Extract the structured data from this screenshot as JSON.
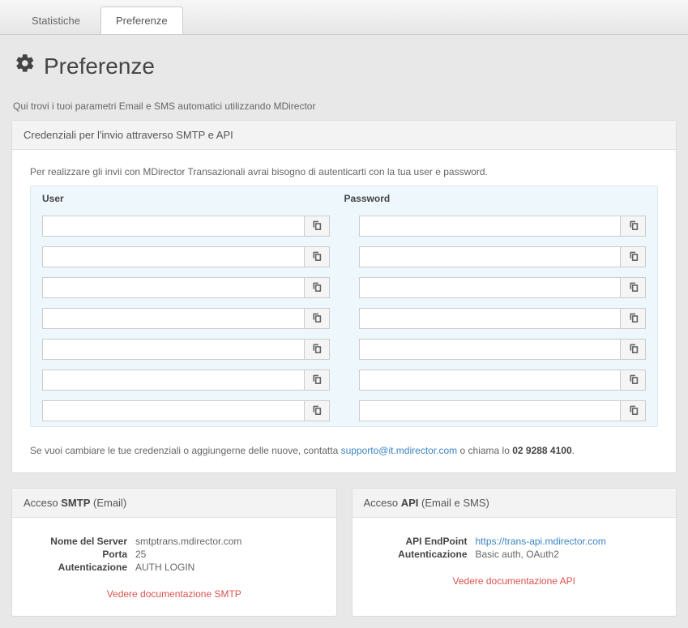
{
  "tabs": {
    "stats": "Statistiche",
    "prefs": "Preferenze"
  },
  "page_title": "Preferenze",
  "intro": "Qui trovi i tuoi parametri Email e SMS automatici utilizzando MDirector",
  "cred_panel": {
    "header": "Credenziali per l'invio attraverso SMTP e API",
    "hint": "Per realizzare gli invii con MDirector Transazionali avrai bisogno di autenticarti con la tua user e password.",
    "col_user": "User",
    "col_password": "Password",
    "rows": [
      {
        "user": "",
        "password": ""
      },
      {
        "user": "",
        "password": ""
      },
      {
        "user": "",
        "password": ""
      },
      {
        "user": "",
        "password": ""
      },
      {
        "user": "",
        "password": ""
      },
      {
        "user": "",
        "password": ""
      },
      {
        "user": "",
        "password": ""
      }
    ],
    "foot_pre": "Se vuoi cambiare le tue credenziali o aggiungerne delle nuove, contatta ",
    "foot_email": "supporto@it.mdirector.com",
    "foot_mid": " o chiama lo ",
    "foot_phone": "02 9288 4100",
    "foot_post": "."
  },
  "smtp_panel": {
    "header_pre": "Acceso ",
    "header_bold": "SMTP",
    "header_post": " (Email)",
    "server_label": "Nome del Server",
    "server_value": "smtptrans.mdirector.com",
    "port_label": "Porta",
    "port_value": "25",
    "auth_label": "Autenticazione",
    "auth_value": "AUTH LOGIN",
    "doc_link": "Vedere documentazione SMTP"
  },
  "api_panel": {
    "header_pre": "Acceso ",
    "header_bold": "API",
    "header_post": " (Email e SMS)",
    "endpoint_label": "API EndPoint",
    "endpoint_value": "https://trans-api.mdirector.com",
    "auth_label": "Autenticazione",
    "auth_value": "Basic auth, OAuth2",
    "doc_link": "Vedere documentazione API"
  }
}
